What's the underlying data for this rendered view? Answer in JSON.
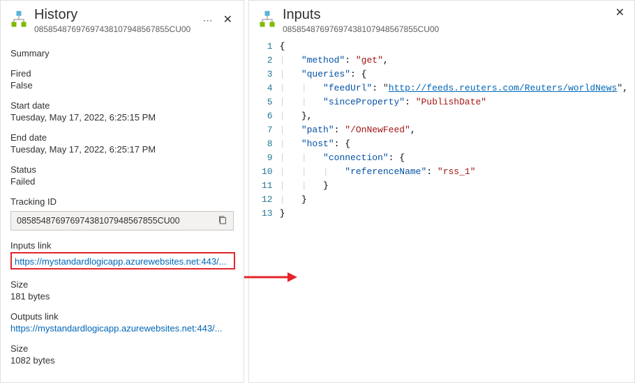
{
  "history": {
    "title": "History",
    "id": "08585487697697438107948567855CU00",
    "summary_label": "Summary",
    "fired_label": "Fired",
    "fired_value": "False",
    "start_label": "Start date",
    "start_value": "Tuesday, May 17, 2022, 6:25:15 PM",
    "end_label": "End date",
    "end_value": "Tuesday, May 17, 2022, 6:25:17 PM",
    "status_label": "Status",
    "status_value": "Failed",
    "tracking_label": "Tracking ID",
    "tracking_value": "08585487697697438107948567855CU00",
    "inputs_link_label": "Inputs link",
    "inputs_link_value": "https://mystandardlogicapp.azurewebsites.net:443/...",
    "inputs_size_label": "Size",
    "inputs_size_value": "181 bytes",
    "outputs_link_label": "Outputs link",
    "outputs_link_value": "https://mystandardlogicapp.azurewebsites.net:443/...",
    "outputs_size_label": "Size",
    "outputs_size_value": "1082 bytes"
  },
  "inputs": {
    "title": "Inputs",
    "id": "08585487697697438107948567855CU00",
    "json": {
      "method": "get",
      "queries": {
        "feedUrl": "http://feeds.reuters.com/Reuters/worldNews",
        "sinceProperty": "PublishDate"
      },
      "path": "/OnNewFeed",
      "host": {
        "connection": {
          "referenceName": "rss_1"
        }
      }
    },
    "lines": [
      "1",
      "2",
      "3",
      "4",
      "5",
      "6",
      "7",
      "8",
      "9",
      "10",
      "11",
      "12",
      "13"
    ]
  }
}
